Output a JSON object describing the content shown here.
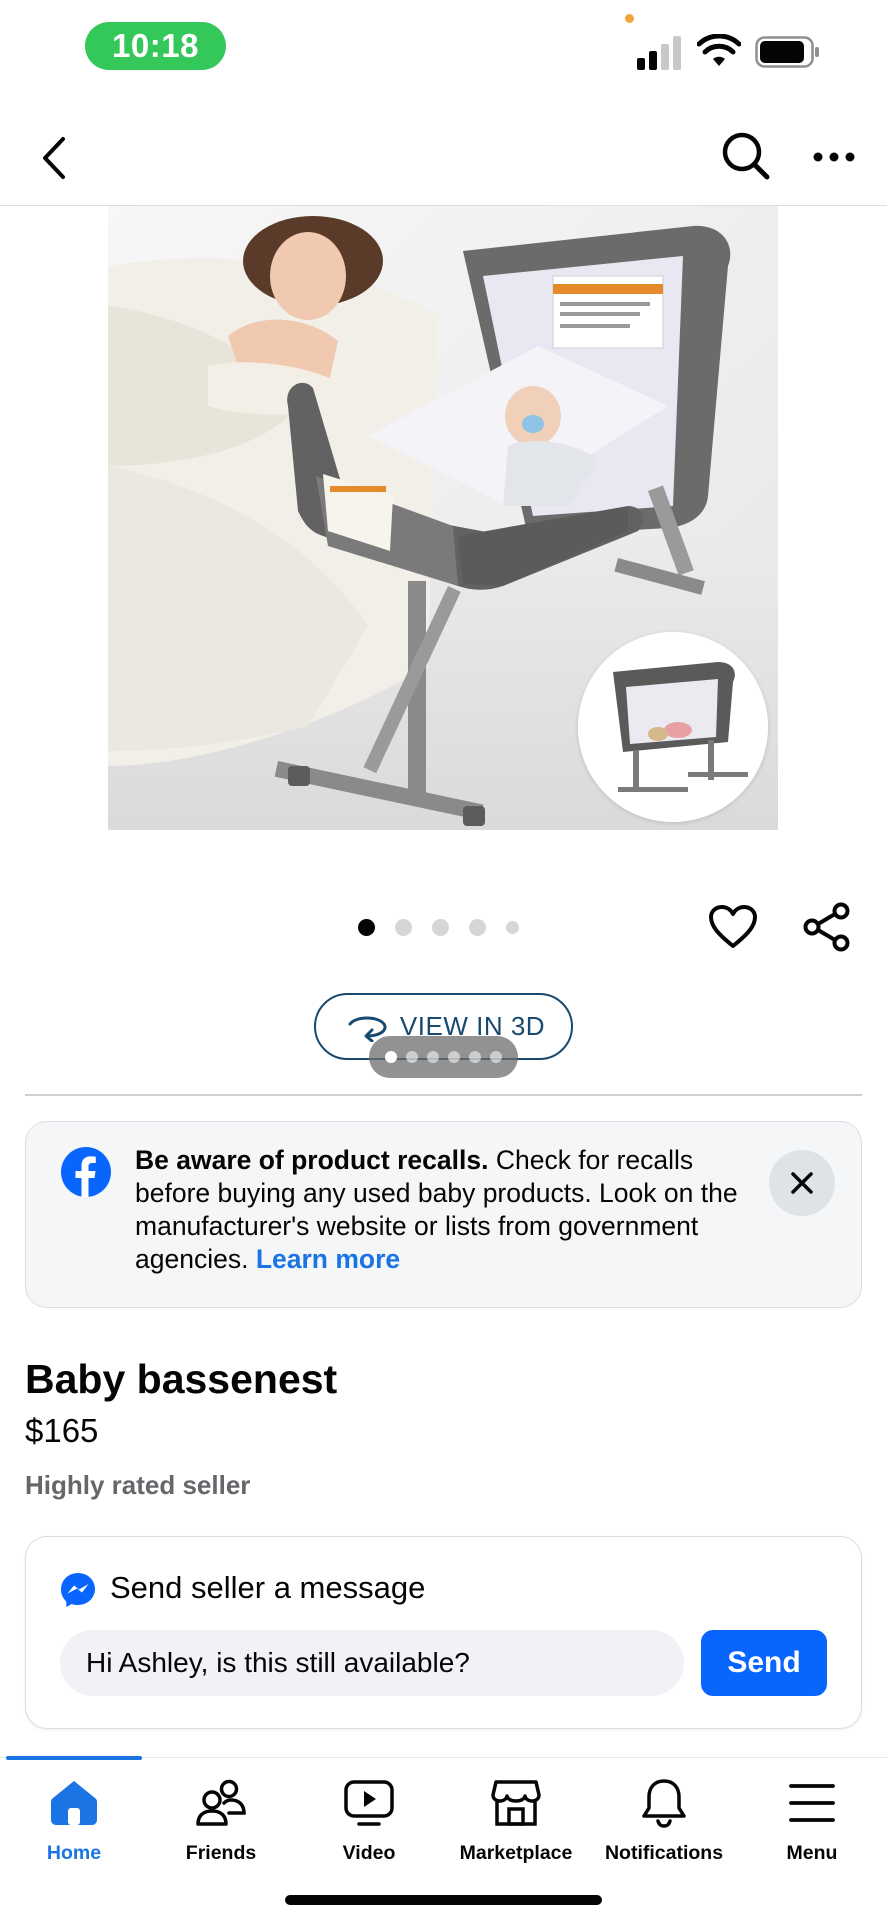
{
  "status_bar": {
    "time": "10:18"
  },
  "nav": {
    "back_icon": "chevron-left-icon",
    "search_icon": "search-icon",
    "more_icon": "more-horizontal-icon"
  },
  "gallery": {
    "dot_count": 5,
    "active_index": 0,
    "carousel_dot_count": 6
  },
  "view3d": {
    "label": "VIEW IN 3D"
  },
  "recall": {
    "heading": "Be aware of product recalls.",
    "body": " Check for recalls before buying any used baby products. Look on the manufacturer's website or lists from government agencies. ",
    "link": "Learn more"
  },
  "listing": {
    "title": "Baby bassenest",
    "price": "$165",
    "seller_badge": "Highly rated seller"
  },
  "message": {
    "header": "Send seller a message",
    "input_value": "Hi Ashley, is this still available?",
    "send_label": "Send"
  },
  "tabs": [
    {
      "label": "Home",
      "icon": "home-icon",
      "active": true
    },
    {
      "label": "Friends",
      "icon": "friends-icon",
      "active": false
    },
    {
      "label": "Video",
      "icon": "video-icon",
      "active": false
    },
    {
      "label": "Marketplace",
      "icon": "marketplace-icon",
      "active": false
    },
    {
      "label": "Notifications",
      "icon": "bell-icon",
      "active": false
    },
    {
      "label": "Menu",
      "icon": "menu-icon",
      "active": false
    }
  ],
  "colors": {
    "accent": "#1b74e4",
    "send_button": "#0866ff",
    "time_pill": "#34c759",
    "secondary_text": "#65676b"
  }
}
